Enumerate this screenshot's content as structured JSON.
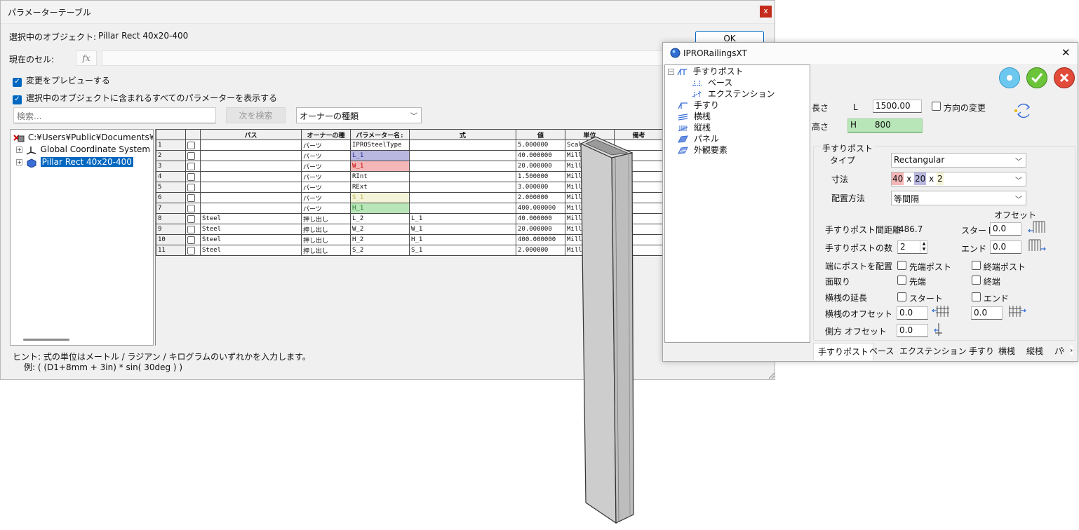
{
  "param_window": {
    "title": "パラメーターテーブル",
    "close_label": "x",
    "selected_object_label": "選択中のオブジェクト:",
    "selected_object_value": "Pillar Rect 40x20-400",
    "ok_label": "OK",
    "current_cell_label": "現在のセル:",
    "fx_label": "fx",
    "preview_label": "変更をプレビューする",
    "show_all_label": "選択中のオブジェクトに含まれるすべてのパラメーターを表示する",
    "search_placeholder": "検索...",
    "next_search_label": "次を検索",
    "owner_type": "オーナーの種類",
    "tree": {
      "root": "C:¥Users¥Public¥Documents¥Iron",
      "item1": "Global Coordinate System",
      "item2": "Pillar Rect 40x20-400"
    },
    "headers": [
      "",
      "",
      "パス",
      "オーナーの種",
      "パラメーター名:",
      "式",
      "値",
      "単位",
      "備考"
    ],
    "rows": [
      {
        "n": "1",
        "path": "",
        "owner": "パーツ",
        "name": "IPROSteelType",
        "expr": "",
        "val": "5.000000",
        "unit": "Scal"
      },
      {
        "n": "2",
        "path": "",
        "owner": "パーツ",
        "name": "L_1",
        "expr": "",
        "val": "40.000000",
        "unit": "Millin"
      },
      {
        "n": "3",
        "path": "",
        "owner": "パーツ",
        "name": "W_1",
        "expr": "",
        "val": "20.000000",
        "unit": "Millin"
      },
      {
        "n": "4",
        "path": "",
        "owner": "パーツ",
        "name": "RInt",
        "expr": "",
        "val": "1.500000",
        "unit": "Millin"
      },
      {
        "n": "5",
        "path": "",
        "owner": "パーツ",
        "name": "RExt",
        "expr": "",
        "val": "3.000000",
        "unit": "Millin"
      },
      {
        "n": "6",
        "path": "",
        "owner": "パーツ",
        "name": "S_1",
        "expr": "",
        "val": "2.000000",
        "unit": "Millin"
      },
      {
        "n": "7",
        "path": "",
        "owner": "パーツ",
        "name": "H_1",
        "expr": "",
        "val": "400.000000",
        "unit": "Millin"
      },
      {
        "n": "8",
        "path": "Steel",
        "owner": "押し出し",
        "name": "L_2",
        "expr": "L_1",
        "val": "40.000000",
        "unit": "Millin"
      },
      {
        "n": "9",
        "path": "Steel",
        "owner": "押し出し",
        "name": "W_2",
        "expr": "W_1",
        "val": "20.000000",
        "unit": "Millin"
      },
      {
        "n": "10",
        "path": "Steel",
        "owner": "押し出し",
        "name": "H_2",
        "expr": "H_1",
        "val": "400.000000",
        "unit": "Millin"
      },
      {
        "n": "11",
        "path": "Steel",
        "owner": "押し出し",
        "name": "S_2",
        "expr": "S_1",
        "val": "2.000000",
        "unit": "Millin"
      }
    ],
    "hint1": "ヒント: 式の単位はメートル / ラジアン / キログラムのいずれかを入力します。",
    "hint2": "例: ( (D1+8mm + 3in) * sin( 30deg ) )"
  },
  "rail_window": {
    "title": "IPRORailingsXT",
    "close_label": "✕",
    "tree": [
      "手すりポスト",
      "ベース",
      "エクステンション",
      "手すり",
      "横桟",
      "縦桟",
      "パネル",
      "外観要素"
    ],
    "length_label": "長さ",
    "length_symbol": "L",
    "length_value": "1500.00",
    "direction_label": "方向の変更",
    "height_label": "高さ",
    "height_symbol": "H",
    "height_value": "800",
    "group_label": "手すりポスト",
    "type_label": "タイプ",
    "type_value": "Rectangular",
    "dim_label": "寸法",
    "dim_a": "40",
    "dim_x1": "x",
    "dim_b": "20",
    "dim_x2": "x",
    "dim_c": "2",
    "placement_label": "配置方法",
    "placement_value": "等間隔",
    "offset_label": "オフセット",
    "spacing_label": "手すりポスト間距離",
    "spacing_value": "486.7",
    "start_label": "スタート",
    "start_value": "0.0",
    "count_label": "手すりポストの数",
    "count_value": "2",
    "end_label": "エンド",
    "end_value": "0.0",
    "endpost_label": "端にポストを配置",
    "first_post_label": "先端ポスト",
    "last_post_label": "終端ポスト",
    "chamfer_label": "面取り",
    "chamfer_first": "先端",
    "chamfer_last": "終端",
    "rail_ext_label": "横桟の延長",
    "rail_ext_start": "スタート",
    "rail_ext_end": "エンド",
    "rail_offset_label": "横桟のオフセット",
    "rail_offset_1": "0.0",
    "rail_offset_2": "0.0",
    "side_offset_label": "側方 オフセット",
    "side_offset_value": "0.0",
    "tabs": [
      "手すりポスト",
      "ベース",
      "エクステンション",
      "手すり",
      "横桟",
      "縦桟",
      "パ"
    ]
  },
  "colors": {
    "accent": "#0067c0",
    "close_red": "#c42b1c",
    "l_highlight": "#b8b8e0",
    "w_highlight": "#f4b6b6",
    "s_highlight": "#f4f4d8",
    "h_highlight": "#b8e6b8"
  }
}
